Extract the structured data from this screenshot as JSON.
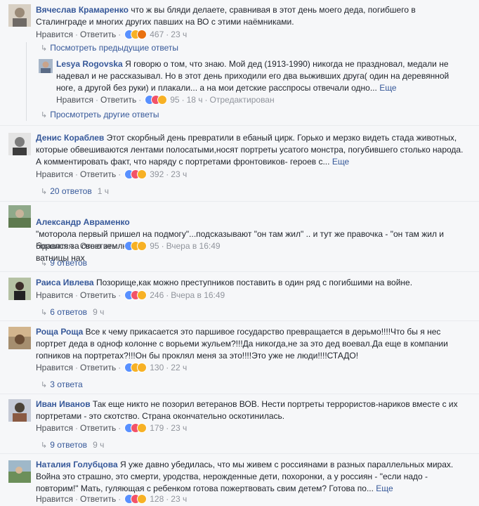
{
  "labels": {
    "like": "Нравится",
    "reply": "Ответить",
    "more": "Еще",
    "edited": "Отредактирован",
    "prev_replies": "Посмотреть предыдущие ответы",
    "other_replies": "Просмотреть другие ответы"
  },
  "comments": [
    {
      "name": "Вячеслав Крамаренко",
      "text": "что ж вы бляди делаете, сравнивая в этот день моего деда, погибшего в Сталинграде и многих других павших на ВО с этими наёмниками.",
      "reactions": [
        "like",
        "haha",
        "angry"
      ],
      "count": "467",
      "time": "23 ч",
      "replies": [
        {
          "name": "Lesya Rogovska",
          "text": "Я говорю о том, что знаю. Мой дед (1913-1990) никогда не праздновал, медали не надевал и не рассказывал. Но в этот день приходили его два выживших друга( один на деревянной ноге, а другой без руки) и плакали... а на мои детские расспросы отвечали одно...",
          "reactions": [
            "like",
            "love",
            "sad"
          ],
          "count": "95",
          "time": "18 ч"
        }
      ]
    },
    {
      "name": "Денис Кораблев",
      "text": "Этот скорбный день превратили в ебаный цирк. Горько и мерзко видеть стада животных, которые обвешиваются лентами полосатыми,носят портреты усатого монстра, погубившего столько народа. А комментировать факт, что наряду с портретами фронтовиков- героев с...",
      "reactions": [
        "like",
        "love",
        "haha"
      ],
      "count": "392",
      "time": "23 ч",
      "replies_label": "20 ответов",
      "replies_time": "1 ч"
    },
    {
      "name": "Александр Авраменко",
      "text": "\"моторола первый пришел на подмогу\"...подсказывают \"он там жил\" .. и тут же правочка - \"он там жил и боролся за свою землю.\"\nватницы нах",
      "reactions": [
        "like",
        "haha",
        "sad"
      ],
      "count": "95",
      "time": "Вчера в 16:49",
      "replies_label": "9 ответов",
      "replies_time": ""
    },
    {
      "name": "Раиса Ивлева",
      "text": "Позорище,как можно преступников поставить в один ряд с погибшими на войне.",
      "reactions": [
        "like",
        "love",
        "sad"
      ],
      "count": "246",
      "time": "Вчера в 16:49",
      "replies_label": "6 ответов",
      "replies_time": "9 ч"
    },
    {
      "name": "Роща Роща",
      "text": "Все к чему прикасается это паршивое государство превращается в дерьмо!!!!Что бы я нес портрет деда в одноф колонне с ворьеми жульем?!!!Да никогда,не за это дед воевал.Да еще в компании гопников на портретах?!!!Он бы проклял меня за это!!!!Это уже не люди!!!!СТАДО!",
      "reactions": [
        "like",
        "haha",
        "wow"
      ],
      "count": "130",
      "time": "22 ч",
      "replies_label": "3 ответа",
      "replies_time": ""
    },
    {
      "name": "Иван Иванов",
      "text": "Так еще никто не позорил ветеранов ВОВ. Нести портреты террористов-нариков вместе с их портретами - это скотство. Страна окончательно оскотинилась.",
      "reactions": [
        "like",
        "love",
        "sad"
      ],
      "count": "179",
      "time": "23 ч",
      "replies_label": "9 ответов",
      "replies_time": "9 ч"
    },
    {
      "name": "Наталия Голубцова",
      "text": "Я уже давно убедилась, что мы живем с россиянами в разных параллельных мирах. Война это страшно, это смерти, уродства, нерожденные дети, похоронки, а у россиян - \"если надо - повторим!\" Мать, гуляющая с ребенком готова пожертвовать свим детем? Готова по...",
      "reactions": [
        "like",
        "love",
        "haha"
      ],
      "count": "128",
      "time": "23 ч"
    }
  ],
  "colors": {
    "name": "#365899",
    "meta": "#90949c",
    "background": "#f6f7f9"
  }
}
